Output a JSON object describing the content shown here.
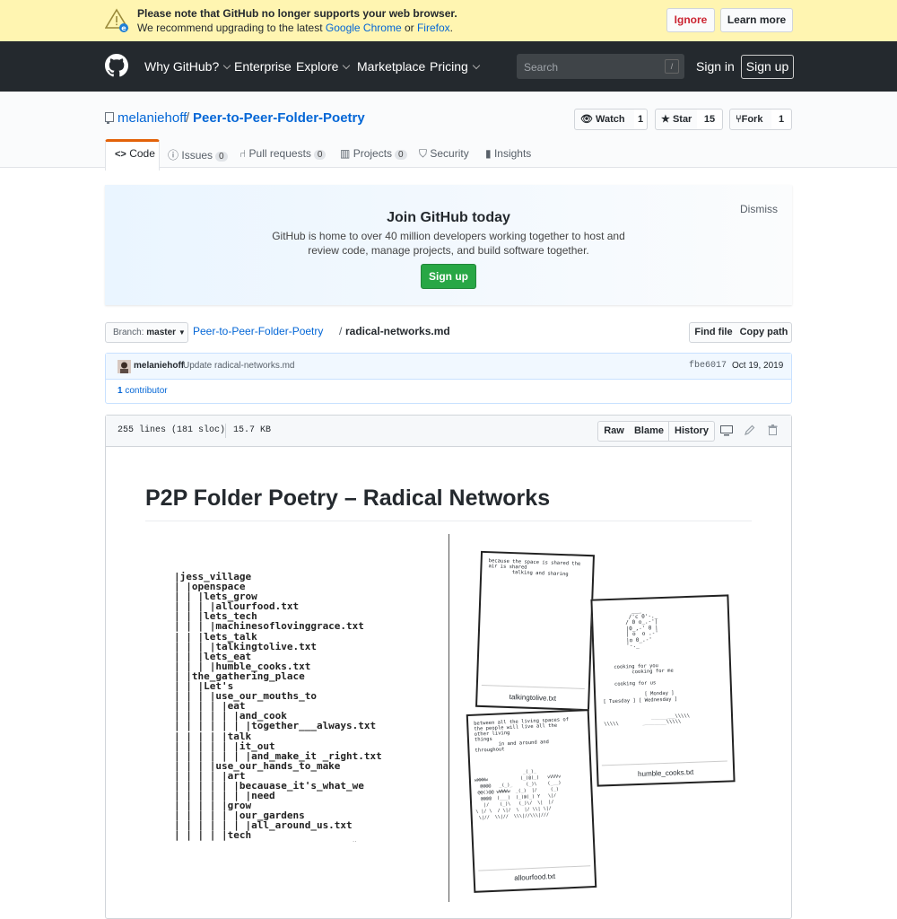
{
  "banner": {
    "line1": "Please note that GitHub no longer supports your web browser.",
    "line2_pre": "We recommend upgrading to the latest ",
    "chrome": "Google Chrome",
    "or": " or ",
    "firefox": "Firefox",
    "end": ".",
    "ignore": "Ignore",
    "learn_more": "Learn more"
  },
  "header": {
    "nav": [
      "Why GitHub?",
      "Enterprise",
      "Explore",
      "Marketplace",
      "Pricing"
    ],
    "search_placeholder": "Search",
    "search_key": "/",
    "sign_in": "Sign in",
    "sign_up": "Sign up"
  },
  "repo": {
    "owner": "melaniehoff",
    "sep": "/",
    "name": "Peer-to-Peer-Folder-Poetry",
    "watch": "Watch",
    "watch_count": "1",
    "star": "Star",
    "star_count": "15",
    "fork": "Fork",
    "fork_count": "1",
    "tabs": [
      {
        "label": "Code"
      },
      {
        "label": "Issues",
        "count": "0"
      },
      {
        "label": "Pull requests",
        "count": "0"
      },
      {
        "label": "Projects",
        "count": "0"
      },
      {
        "label": "Security"
      },
      {
        "label": "Insights"
      }
    ]
  },
  "join": {
    "title": "Join GitHub today",
    "line1": "GitHub is home to over 40 million developers working together to host and",
    "line2": "review code, manage projects, and build software together.",
    "signup": "Sign up",
    "dismiss": "Dismiss"
  },
  "filenav": {
    "branch_label": "Branch:",
    "branch": "master",
    "repo": "Peer-to-Peer-Folder-Poetry",
    "sep": "/",
    "file": "radical-networks.md",
    "find_file": "Find file",
    "copy_path": "Copy path"
  },
  "commit": {
    "author": "melaniehoff",
    "message": "Update radical-networks.md",
    "sha": "fbe6017",
    "date": "Oct 19, 2019",
    "contributors_count": "1",
    "contributors_label": "contributor"
  },
  "fileinfo": {
    "lines": "255 lines (181 sloc)",
    "size": "15.7 KB",
    "raw": "Raw",
    "blame": "Blame",
    "history": "History"
  },
  "content": {
    "title": "P2P Folder Poetry – Radical Networks",
    "tree": [
      "|jess_village",
      "| |openspace",
      "| | |lets_grow",
      "| | | |allourfood.txt",
      "| | |lets_tech",
      "| | | |machinesoflovinggrace.txt",
      "| | |lets_talk",
      "| | | |talkingtolive.txt",
      "| | |lets_eat",
      "| | | |humble_cooks.txt",
      "| |the_gathering_place",
      "| | |Let's",
      "| | | |use_our_mouths_to",
      "| | | | |eat",
      "| | | | | |and_cook",
      "| | | | | | |together___always.txt",
      "| | | | |talk",
      "| | | | | |it_out",
      "| | | | | | |and_make_it _right.txt",
      "| | | |use_our_hands_to_make",
      "| | | | |art",
      "| | | | | |becauase_it's_what_we",
      "| | | | | | |need",
      "| | | | |grow",
      "| | | | | |our_gardens",
      "| | | | | | |all_around_us.txt",
      "| | | | |tech"
    ],
    "card1": {
      "text": "because the space is shared the\nair is shared\n        talking and sharing",
      "caption": "talkingtolive.txt"
    },
    "card2": {
      "art": "  ___\n /'c 0'-._\n/ 0 o_.-'|\n|0_,-' 0 |\n| o  o .-'\n|o 0_.-'\n'-._",
      "text": "    cooking for you\n          cooking for me\n\n    cooking for us\n\n              [ Monday ]\n[ Tuesday ] [ Wednesday ]\n\n\n                ________\\\\\\\\\\\n\\\\\\\\\\        ________\\\\\\\\\\",
      "caption": "humble_cooks.txt"
    },
    "card3": {
      "text": "between all the living spaces of\nthe people will live all the\nother living\nthings\n        in and around and\nthroughout",
      "art": "                  _(_)_\nwWWWw            (_)@(_)   vVVVv\n  @@@@   _(_)_     (_)\\    (___)\n @@()@@ wWWWw  _(_)  |/     (_)\n  @@@@  (___)  (_)@(_) Y   \\|/ \n   |/    (_)\\   (_)\\/  \\|  |/\n\\ |/ \\  / \\|/  \\  |/ \\\\| \\|/\n \\|//  \\\\|//  \\\\\\|//\\\\\\|///",
      "caption": "allourfood.txt"
    }
  }
}
